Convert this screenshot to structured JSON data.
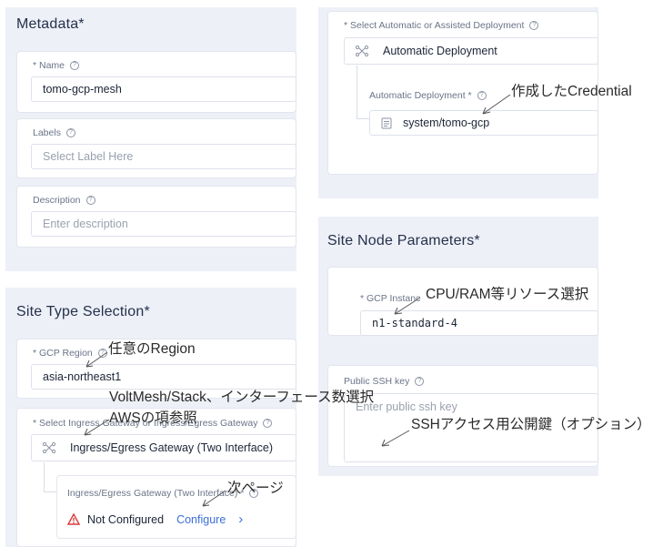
{
  "left": {
    "metadata": {
      "title": "Metadata*",
      "name_label": "* Name",
      "name_value": "tomo-gcp-mesh",
      "labels_label": "Labels",
      "labels_placeholder": "Select Label Here",
      "description_label": "Description",
      "description_placeholder": "Enter description"
    },
    "site_type": {
      "title": "Site Type Selection*",
      "region_label": "* GCP Region",
      "region_value": "asia-northeast1",
      "gateway_label": "* Select Ingress Gateway or Ingress/Egress Gateway",
      "gateway_value": "Ingress/Egress Gateway (Two Interface)",
      "sub_label": "Ingress/Egress Gateway (Two Interface) *",
      "status": "Not Configured",
      "configure": "Configure",
      "chevron": "›"
    }
  },
  "right": {
    "deployment": {
      "label": "* Select Automatic or Assisted Deployment",
      "value": "Automatic Deployment",
      "sub_label": "Automatic Deployment *",
      "credential": "system/tomo-gcp"
    },
    "node": {
      "title": "Site Node Parameters*",
      "instance_label": "* GCP Instanc",
      "instance_value": "n1-standard-4",
      "ssh_label": "Public SSH key",
      "ssh_placeholder": "Enter public ssh key"
    }
  },
  "annotations": {
    "credential": "作成したCredential",
    "region": "任意のRegion",
    "voltmesh": "VoltMesh/Stack、インターフェース数選択",
    "aws": "AWSの項参照",
    "next_page": "次ページ",
    "cpu_ram": "CPU/RAM等リソース選択",
    "ssh": "SSHアクセス用公開鍵（オプション）"
  },
  "colors": {
    "panel_bg": "#eef0f8",
    "link": "#3c6fd8",
    "warning": "#d93a3a"
  }
}
